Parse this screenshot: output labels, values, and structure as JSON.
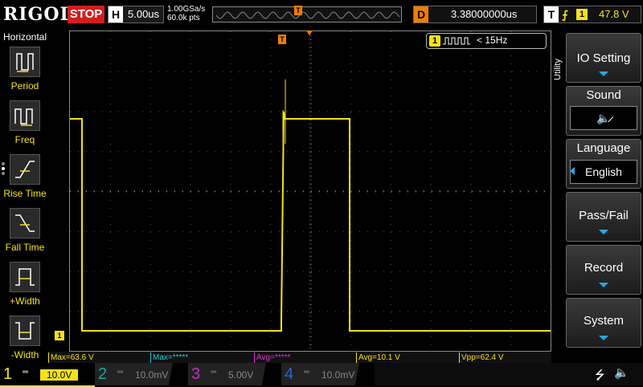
{
  "topbar": {
    "logo": "RIGOL",
    "run_state": "STOP",
    "timebase_key": "H",
    "timebase": "5.00us",
    "sample_rate": "1.00GSa/s",
    "mem_depth": "60.0k pts",
    "trigger_marker": "T",
    "delay_key": "D",
    "delay": "3.38000000us",
    "trigger_key": "T",
    "trigger_edge": "rising-edge-icon",
    "trigger_source": "1",
    "trigger_level": "47.8 V"
  },
  "left_panel": {
    "title": "Horizontal",
    "items": [
      {
        "label": "Period",
        "icon": "period-icon"
      },
      {
        "label": "Freq",
        "icon": "freq-icon"
      },
      {
        "label": "Rise Time",
        "icon": "rise-time-icon"
      },
      {
        "label": "Fall Time",
        "icon": "fall-time-icon"
      },
      {
        "label": "+Width",
        "icon": "positive-width-icon"
      },
      {
        "label": "-Width",
        "icon": "negative-width-icon"
      }
    ]
  },
  "freq_badge": {
    "channel": "1",
    "value": "< 15Hz"
  },
  "ground_marker": "1",
  "trigger_level_marker": "T",
  "right_menu": {
    "section": "Utility",
    "items": [
      {
        "label": "IO Setting",
        "has_arrow": true
      },
      {
        "label": "Sound",
        "value_icon": "speaker-muted-icon"
      },
      {
        "label": "Language",
        "value": "English"
      },
      {
        "label": "Pass/Fail",
        "has_arrow": true
      },
      {
        "label": "Record",
        "has_arrow": true
      },
      {
        "label": "System",
        "has_arrow": true
      }
    ]
  },
  "measurements": [
    {
      "label": "Max=63.6 V",
      "color": "#f5e11a"
    },
    {
      "label": "Max=*****",
      "color": "#27c9e1"
    },
    {
      "label": "Avg=*****",
      "color": "#e030e0"
    },
    {
      "label": "Avg=10.1 V",
      "color": "#f5e11a"
    },
    {
      "label": "Vpp=62.4 V",
      "color": "#f5e11a"
    }
  ],
  "channels": [
    {
      "num": "1",
      "value": "10.0V",
      "color": "#f5e11a",
      "active": true
    },
    {
      "num": "2",
      "value": "10.0mV",
      "color": "#1fa3a3",
      "active": false
    },
    {
      "num": "3",
      "value": "5.00V",
      "color": "#c030c0",
      "active": false
    },
    {
      "num": "4",
      "value": "10.0mV",
      "color": "#3060d0",
      "active": false
    }
  ],
  "status_icons": [
    "usb-icon",
    "speaker-muted-icon"
  ],
  "colors": {
    "ch1": "#f5e11a",
    "trigger": "#f07d00",
    "stop": "#d31d1d",
    "accent": "#27a9e1"
  }
}
